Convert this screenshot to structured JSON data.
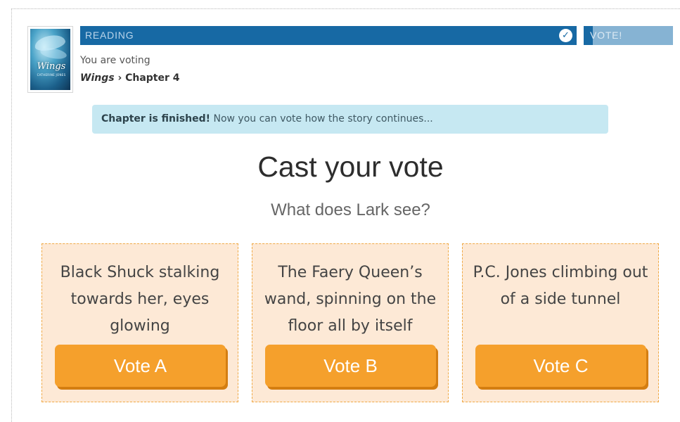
{
  "book": {
    "cover_title": "Wings",
    "cover_author": "CATHERINE JONES"
  },
  "progress": {
    "reading_label": "READING",
    "reading_done_icon": "check-circle-icon",
    "vote_label": "VOTE!",
    "vote_progress": 0.1
  },
  "header": {
    "voting_text": "You are voting",
    "book_title": "Wings",
    "separator": "›",
    "chapter": "Chapter 4"
  },
  "alert": {
    "strong": "Chapter is finished!",
    "text": " Now you can vote how the story continues..."
  },
  "main": {
    "heading": "Cast your vote",
    "question": "What does Lark see?"
  },
  "options": [
    {
      "text": "Black Shuck stalking towards her, eyes glowing",
      "button": "Vote A"
    },
    {
      "text": "The Faery Queen’s wand, spinning on the floor all by itself",
      "button": "Vote B"
    },
    {
      "text": "P.C. Jones climbing out of a side tunnel",
      "button": "Vote C"
    }
  ],
  "colors": {
    "progress_blue": "#1769a4",
    "vote_light_blue": "#86b3d3",
    "alert_bg": "#c6e8f2",
    "card_bg": "#fde9d6",
    "button_orange": "#f5a02c"
  }
}
